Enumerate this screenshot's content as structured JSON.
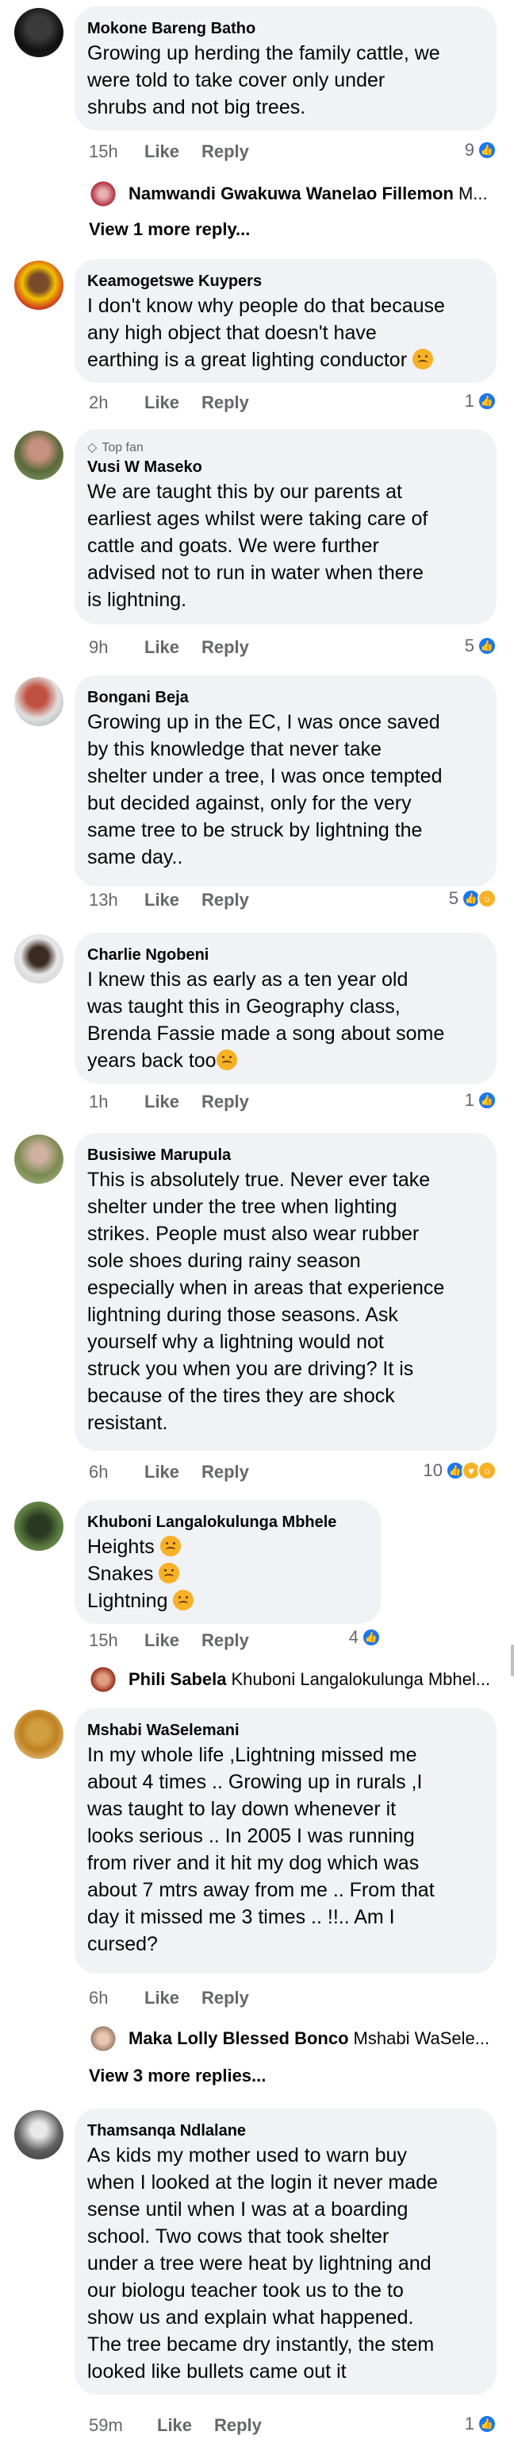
{
  "labels": {
    "like": "Like",
    "reply": "Reply",
    "top_fan": "Top fan"
  },
  "comments": [
    {
      "author": "Mokone Bareng Batho",
      "text": [
        "Growing up herding the family cattle, we",
        "were told to take cover only under",
        "shrubs and not big trees."
      ],
      "time": "15h",
      "reactions": "9",
      "reply_preview": {
        "name": "Namwandi Gwakuwa Wanelao Fillemon",
        "text": "M..."
      },
      "view_more": "View 1 more reply..."
    },
    {
      "author": "Keamogetswe Kuypers",
      "text": [
        "I don't know why people do that because",
        "any high object that doesn't have",
        "earthing is a great lighting conductor"
      ],
      "time": "2h",
      "reactions": "1"
    },
    {
      "author": "Vusi W Maseko",
      "text": [
        "We are taught this by our parents at",
        "earliest ages whilst were taking care of",
        "cattle and goats. We were further",
        "advised not to run in water when there",
        "is lightning."
      ],
      "time": "9h",
      "reactions": "5"
    },
    {
      "author": "Bongani Beja",
      "text": [
        "Growing up in the EC, I was once saved",
        "by this knowledge that never take",
        "shelter under a tree, I was once tempted",
        "but decided against, only for the very",
        "same tree to be struck by lightning the",
        "same day.."
      ],
      "time": "13h",
      "reactions": "5"
    },
    {
      "author": "Charlie Ngobeni",
      "text": [
        "I knew this as early as a ten year old",
        "was taught this in Geography class,",
        "Brenda Fassie made a song about some",
        "years back too"
      ],
      "time": "1h",
      "reactions": "1"
    },
    {
      "author": "Busisiwe Marupula",
      "text": [
        "This is absolutely true. Never ever take",
        "shelter under the tree when lighting",
        "strikes. People must also wear rubber",
        "sole shoes during rainy season",
        "especially when in areas that experience",
        "lightning during those seasons. Ask",
        "yourself why a lightning would not",
        "struck you when you are driving? It is",
        "because of the tires they are shock",
        "resistant."
      ],
      "time": "6h",
      "reactions": "10"
    },
    {
      "author": "Khuboni Langalokulunga Mbhele",
      "text": [
        "Heights",
        "Snakes",
        "Lightning"
      ],
      "time": "15h",
      "reactions": "4",
      "reply_preview": {
        "name": "Phili Sabela",
        "text": "Khuboni Langalokulunga Mbhel..."
      }
    },
    {
      "author": "Mshabi WaSelemani",
      "text": [
        "In my whole life ,Lightning missed me",
        "about 4 times .. Growing up in rurals ,I",
        "was taught to lay down whenever it",
        "looks serious .. In 2005 I was running",
        "from river and it hit my dog which was",
        "about 7 mtrs away from me .. From that",
        "day it missed me 3 times .. !!.. Am I",
        "cursed?"
      ],
      "time": "6h",
      "reply_preview": {
        "name": "Maka Lolly Blessed Bonco",
        "text": "Mshabi WaSele..."
      },
      "view_more": "View 3 more replies..."
    },
    {
      "author": "Thamsanqa Ndlalane",
      "text": [
        "As kids my mother used to warn buy",
        "when I looked at the login it never made",
        "sense until when I was at a boarding",
        "school. Two cows that took shelter",
        "under a tree were heat by lightning and",
        "our biologu teacher took us to the to",
        "show us and explain what happened.",
        "The tree became dry instantly, the stem",
        "looked like bullets came out it"
      ],
      "time": "59m",
      "reactions": "1"
    }
  ]
}
